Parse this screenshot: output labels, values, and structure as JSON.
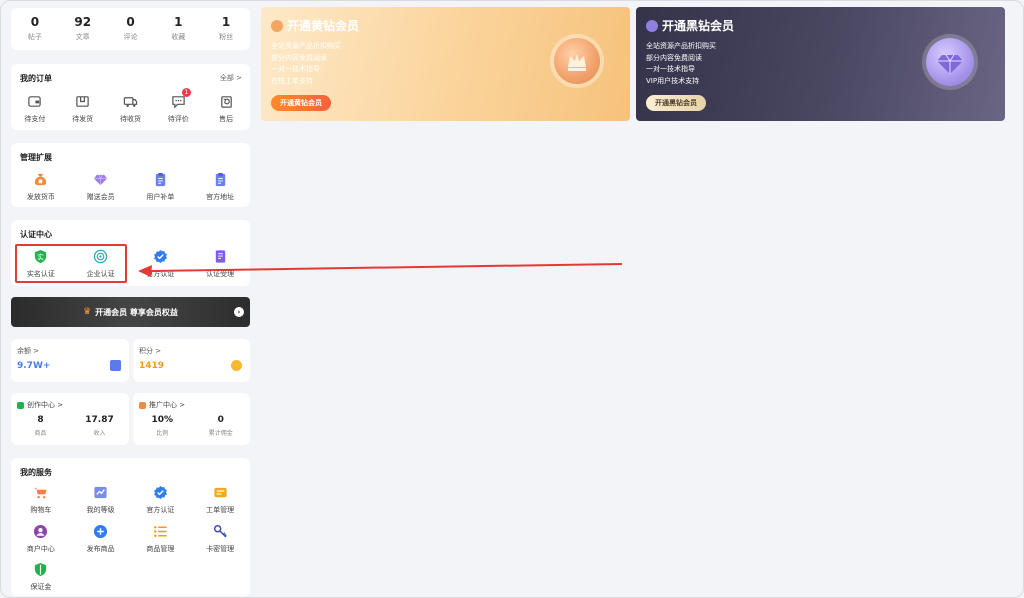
{
  "stats": [
    {
      "num": "0",
      "label": "帖子"
    },
    {
      "num": "92",
      "label": "文章"
    },
    {
      "num": "0",
      "label": "评论"
    },
    {
      "num": "1",
      "label": "收藏"
    },
    {
      "num": "1",
      "label": "粉丝"
    }
  ],
  "orders": {
    "title": "我的订单",
    "more": "全部 >",
    "items": [
      {
        "label": "待支付",
        "icon": "wallet-icon"
      },
      {
        "label": "待发货",
        "icon": "box-icon"
      },
      {
        "label": "待收货",
        "icon": "truck-icon"
      },
      {
        "label": "待评价",
        "icon": "comment-icon",
        "badge": "1"
      },
      {
        "label": "售后",
        "icon": "refund-icon"
      }
    ]
  },
  "manage": {
    "title": "管理扩展",
    "items": [
      {
        "label": "发放货币",
        "icon": "money-bag-icon"
      },
      {
        "label": "赠送会员",
        "icon": "diamond-icon"
      },
      {
        "label": "用户补单",
        "icon": "clipboard-icon"
      },
      {
        "label": "官方地址",
        "icon": "clipboard-icon"
      }
    ]
  },
  "cert": {
    "title": "认证中心",
    "items": [
      {
        "label": "实名认证",
        "icon": "id-shield-icon",
        "glyph": "实"
      },
      {
        "label": "企业认证",
        "icon": "enterprise-icon"
      },
      {
        "label": "官方认证",
        "icon": "verified-icon"
      },
      {
        "label": "认证受理",
        "icon": "document-icon"
      }
    ]
  },
  "banner": {
    "label": "开通会员 尊享会员权益",
    "arrow": "›"
  },
  "balance": {
    "label": "余额 >",
    "value": "9.7W+"
  },
  "points": {
    "label": "积分 >",
    "value": "1419"
  },
  "creator": {
    "title": "创作中心 >",
    "cols": [
      {
        "num": "8",
        "label": "商品"
      },
      {
        "num": "17.87",
        "label": "收入"
      }
    ]
  },
  "promo": {
    "title": "推广中心 >",
    "cols": [
      {
        "num": "10%",
        "label": "比例"
      },
      {
        "num": "0",
        "label": "累计佣金"
      }
    ]
  },
  "services": {
    "title": "我的服务",
    "items": [
      {
        "label": "购物车",
        "icon": "cart-icon"
      },
      {
        "label": "我的等级",
        "icon": "chart-icon"
      },
      {
        "label": "官方认证",
        "icon": "verified-icon"
      },
      {
        "label": "工单管理",
        "icon": "ticket-icon"
      },
      {
        "label": "商户中心",
        "icon": "user-circle-icon"
      },
      {
        "label": "发布商品",
        "icon": "plus-circle-icon"
      },
      {
        "label": "商品管理",
        "icon": "list-icon"
      },
      {
        "label": "卡密管理",
        "icon": "key-icon"
      },
      {
        "label": "保证金",
        "icon": "shield-icon"
      }
    ]
  },
  "vip_gold": {
    "title": "开通黄钻会员",
    "lines": [
      "全站资源产品折扣购买",
      "部分内容免费阅读",
      "一对一技术指导",
      "在线工单支持"
    ],
    "button": "开通黄钻会员"
  },
  "vip_black": {
    "title": "开通黑钻会员",
    "lines": [
      "全站资源产品折扣购买",
      "部分内容免费阅读",
      "一对一技术指导",
      "VIP用户技术支持"
    ],
    "button": "开通黑钻会员"
  },
  "colors": {
    "accent_red": "#e53935",
    "blue": "#4a7cf0",
    "orange": "#f39c12"
  }
}
